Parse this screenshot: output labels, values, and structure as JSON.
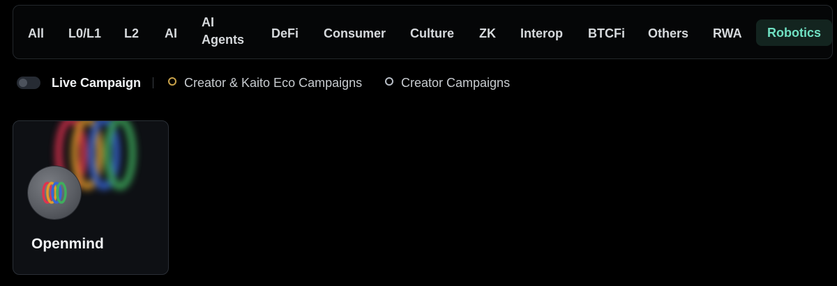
{
  "tabs": [
    {
      "label": "All"
    },
    {
      "label": "L0/L1"
    },
    {
      "label": "L2"
    },
    {
      "label": "AI"
    },
    {
      "label": "AI Agents"
    },
    {
      "label": "DeFi"
    },
    {
      "label": "Consumer"
    },
    {
      "label": "Culture"
    },
    {
      "label": "ZK"
    },
    {
      "label": "Interop"
    },
    {
      "label": "BTCFi"
    },
    {
      "label": "Others"
    },
    {
      "label": "RWA"
    },
    {
      "label": "Robotics",
      "active": true
    }
  ],
  "filters": {
    "live_campaign_label": "Live Campaign",
    "live_campaign_on": false,
    "legend_creator_kaito": "Creator & Kaito Eco Campaigns",
    "legend_creator": "Creator Campaigns"
  },
  "colors": {
    "accent": "#6fe0c2",
    "active_tab_bg": "#13241f",
    "ring_gold": "#c9a24a",
    "ring_silver": "#b8bec6"
  },
  "cards": [
    {
      "name": "Openmind",
      "icon": "openmind-logo-icon"
    }
  ]
}
